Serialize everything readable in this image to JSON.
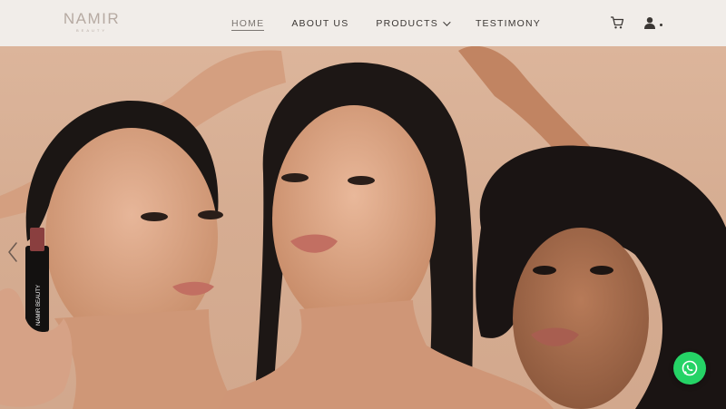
{
  "brand": {
    "name": "NAMIR",
    "subtitle": "BEAUTY"
  },
  "nav": {
    "items": [
      {
        "label": "HOME",
        "active": true
      },
      {
        "label": "ABOUT US",
        "active": false
      },
      {
        "label": "PRODUCTS",
        "active": false,
        "has_dropdown": true
      },
      {
        "label": "TESTIMONY",
        "active": false
      }
    ]
  },
  "header_icons": {
    "cart": "cart-icon",
    "user": "user-icon"
  },
  "hero": {
    "image_description": "three-models-beauty-photo",
    "product_label": "NAMIR BEAUTY"
  },
  "floating": {
    "whatsapp": "whatsapp-icon"
  },
  "colors": {
    "header_bg": "#f1ede9",
    "hero_bg": "#d6ad92",
    "whatsapp_green": "#25d366",
    "nav_text": "#3b3734"
  }
}
